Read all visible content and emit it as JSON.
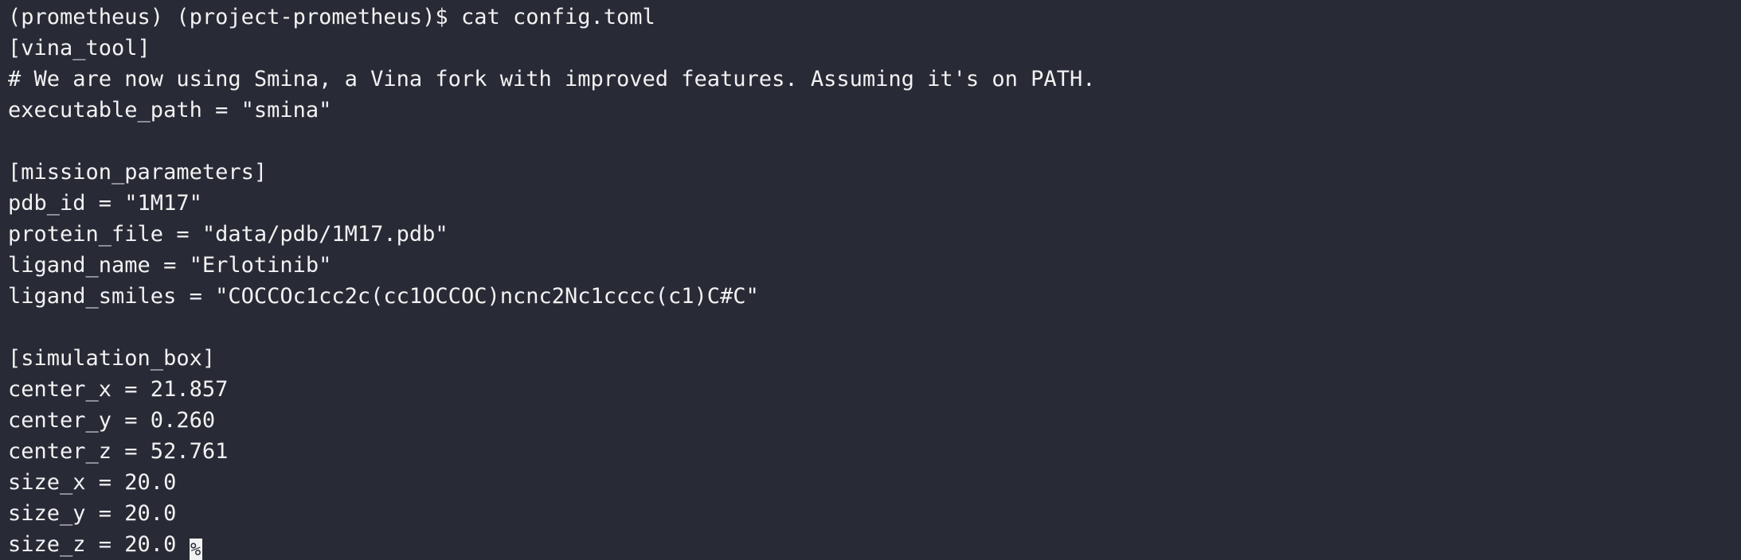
{
  "terminal": {
    "lines": [
      "(prometheus) (project-prometheus)$ cat config.toml",
      "[vina_tool]",
      "# We are now using Smina, a Vina fork with improved features. Assuming it's on PATH.",
      "executable_path = \"smina\"",
      "",
      "[mission_parameters]",
      "pdb_id = \"1M17\"",
      "protein_file = \"data/pdb/1M17.pdb\"",
      "ligand_name = \"Erlotinib\"",
      "ligand_smiles = \"COCCOc1cc2c(cc1OCCOC)ncnc2Nc1cccc(c1)C#C\"",
      "",
      "[simulation_box]",
      "center_x = 21.857",
      "center_y = 0.260",
      "center_z = 52.761",
      "size_x = 20.0",
      "size_y = 20.0",
      "size_z = 20.0 "
    ],
    "cursor_char": "%",
    "colors": {
      "background": "#282a36",
      "foreground": "#f2f2f2"
    }
  }
}
